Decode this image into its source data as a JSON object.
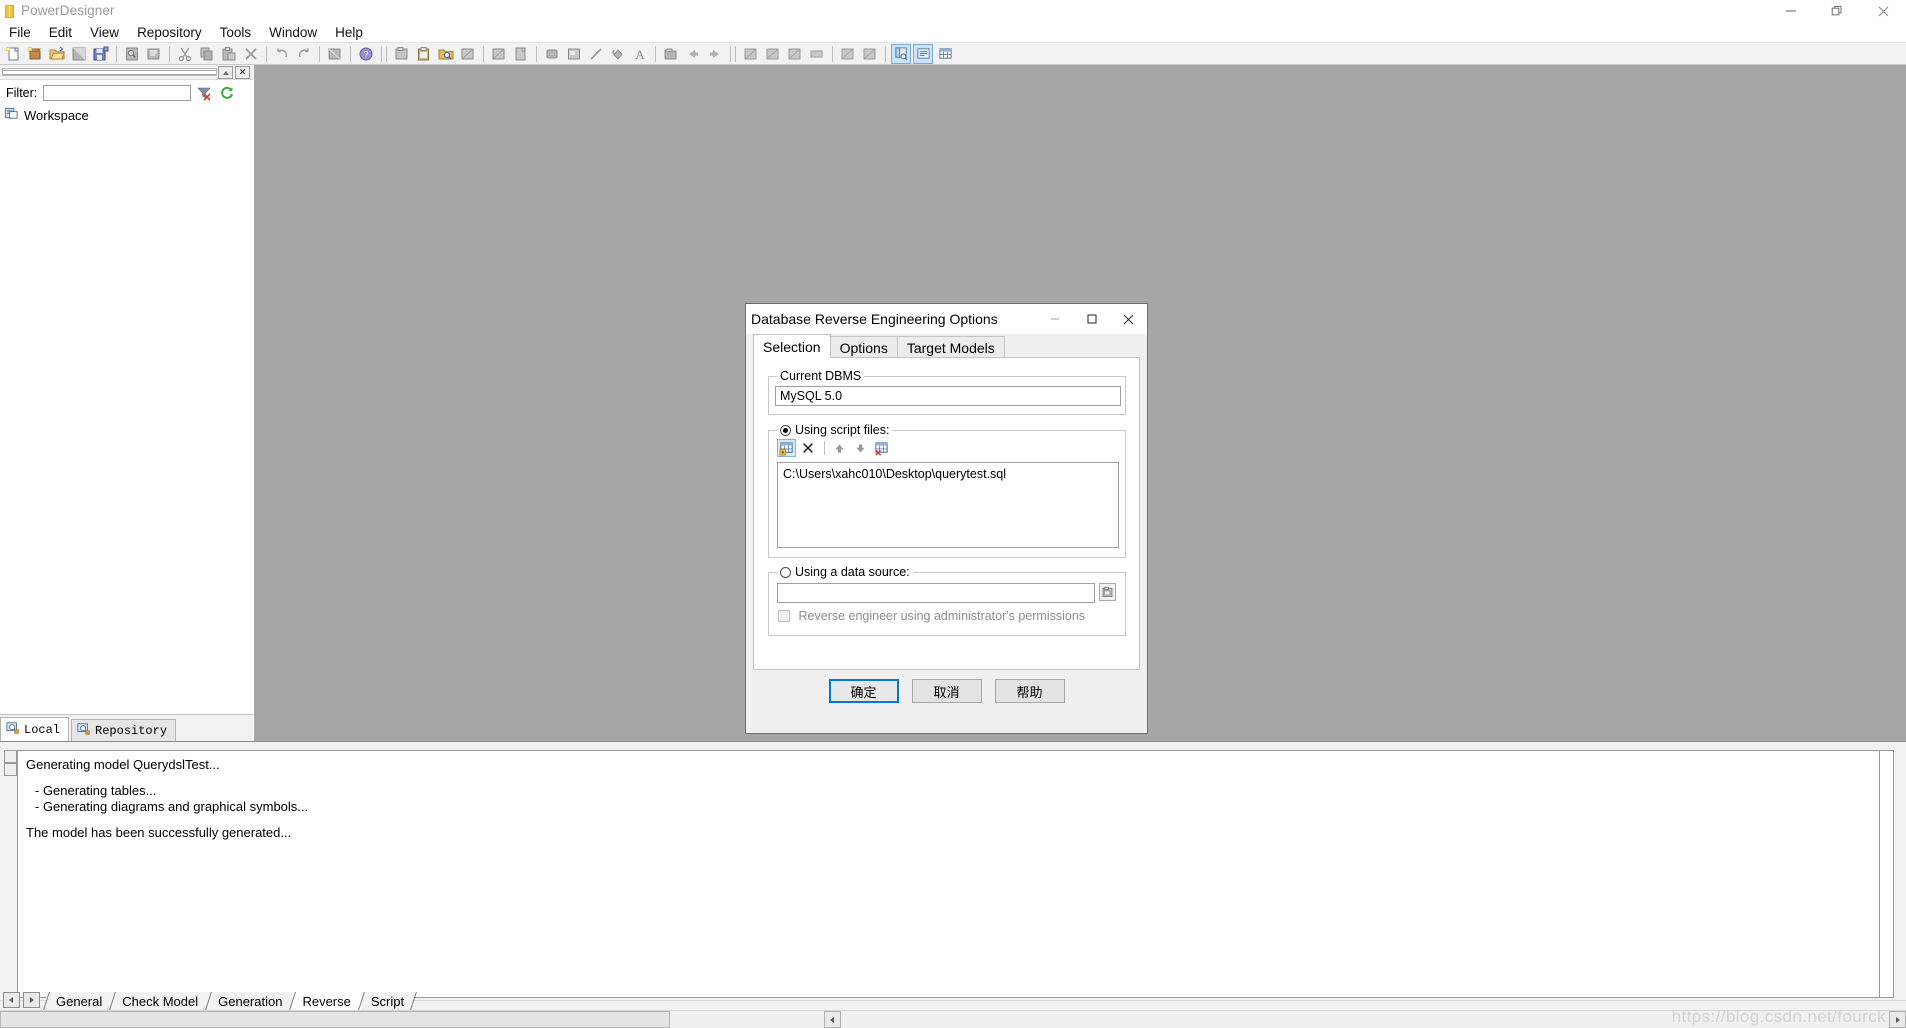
{
  "app": {
    "title": "PowerDesigner",
    "window_icon": "powerdesigner-icon",
    "window_buttons": [
      "minimize-icon",
      "restore-icon",
      "close-icon"
    ]
  },
  "menubar": {
    "items": [
      {
        "label": "File",
        "name": "menu-file"
      },
      {
        "label": "Edit",
        "name": "menu-edit"
      },
      {
        "label": "View",
        "name": "menu-view"
      },
      {
        "label": "Repository",
        "name": "menu-repository"
      },
      {
        "label": "Tools",
        "name": "menu-tools"
      },
      {
        "label": "Window",
        "name": "menu-window"
      },
      {
        "label": "Help",
        "name": "menu-help"
      }
    ]
  },
  "toolbar": {
    "groups": [
      {
        "buttons": [
          "new-model-icon",
          "new-package-icon",
          "open-icon",
          "save-icon",
          "save-all-icon"
        ]
      },
      {
        "buttons": [
          "print-preview-icon",
          "print-icon"
        ]
      },
      {
        "buttons": [
          "cut-icon",
          "copy-icon",
          "paste-icon",
          "delete-icon"
        ]
      },
      {
        "buttons": [
          "undo-icon",
          "redo-icon"
        ]
      },
      {
        "buttons": [
          "properties-icon"
        ]
      },
      {
        "buttons": [
          "help-icon"
        ]
      },
      {
        "buttons": [
          "new-diagram-icon",
          "clipboard-icon",
          "find-folder-icon",
          "zoom-icon"
        ]
      },
      {
        "buttons": [
          "zoom-fit-icon",
          "page-icon"
        ]
      },
      {
        "buttons": [
          "shape-icon",
          "note-icon",
          "line-icon",
          "fill-icon",
          "text-icon"
        ]
      },
      {
        "buttons": [
          "package-icon",
          "link-left-icon",
          "link-right-icon"
        ]
      },
      {
        "buttons": [
          "view-a-icon",
          "view-b-icon",
          "view-c-icon",
          "view-d-icon"
        ]
      },
      {
        "buttons": [
          "view-e-icon",
          "view-f-icon"
        ]
      },
      {
        "buttons": [
          "browser-toggle-icon",
          "output-toggle-icon",
          "result-list-icon"
        ]
      }
    ]
  },
  "browser": {
    "grip_buttons": [
      "collapse-icon",
      "close-panel-icon"
    ],
    "filter": {
      "label": "Filter:",
      "value": "",
      "placeholder": "",
      "clear_icon": "clear-filter-icon",
      "refresh_icon": "refresh-icon"
    },
    "tree": [
      {
        "label": "Workspace",
        "icon": "workspace-icon"
      }
    ],
    "tabs": [
      {
        "label": "Local",
        "icon": "local-icon",
        "active": true
      },
      {
        "label": "Repository",
        "icon": "repository-icon",
        "active": false
      }
    ]
  },
  "output": {
    "lines": [
      {
        "text": "Generating model QuerydslTest...",
        "indent": false
      },
      {
        "text": "",
        "indent": false
      },
      {
        "text": "- Generating tables...",
        "indent": true
      },
      {
        "text": "- Generating diagrams and graphical symbols...",
        "indent": true
      },
      {
        "text": "",
        "indent": false
      },
      {
        "text": "The model has been successfully generated...",
        "indent": false
      }
    ],
    "tabs": [
      {
        "label": "General",
        "active": false
      },
      {
        "label": "Check Model",
        "active": false
      },
      {
        "label": "Generation",
        "active": false
      },
      {
        "label": "Reverse",
        "active": true
      },
      {
        "label": "Script",
        "active": false
      }
    ],
    "nav_prev_icon": "scroll-left-icon",
    "nav_next_icon": "scroll-right-icon",
    "watermark": "https://blog.csdn.net/fourck"
  },
  "dialog": {
    "title": "Database Reverse Engineering Options",
    "window_buttons": [
      "minimize-icon",
      "maximize-icon",
      "close-icon"
    ],
    "tabs": [
      {
        "label": "Selection",
        "active": true
      },
      {
        "label": "Options",
        "active": false
      },
      {
        "label": "Target Models",
        "active": false
      }
    ],
    "current_dbms": {
      "group_label": "Current DBMS",
      "value": "MySQL 5.0"
    },
    "script_files": {
      "group_label": "Using script files:",
      "selected": true,
      "toolbar": [
        {
          "name": "add-script-file-icon",
          "active": true
        },
        {
          "name": "delete-script-file-icon",
          "active": false
        },
        {
          "name": "move-up-icon",
          "active": false
        },
        {
          "name": "move-down-icon",
          "active": false
        },
        {
          "name": "remove-all-icon",
          "active": false
        }
      ],
      "files": [
        "C:\\Users\\xahc010\\Desktop\\querytest.sql"
      ]
    },
    "data_source": {
      "group_label": "Using a data source:",
      "selected": false,
      "value": "",
      "browse_icon": "data-source-browse-icon",
      "admin_checkbox": {
        "label": "Reverse engineer using administrator's permissions",
        "checked": false,
        "enabled": false
      }
    },
    "buttons": [
      {
        "label": "确定",
        "name": "ok-button",
        "default": true
      },
      {
        "label": "取消",
        "name": "cancel-button",
        "default": false
      },
      {
        "label": "帮助",
        "name": "help-button",
        "default": false
      }
    ]
  },
  "colors": {
    "workspace_bg": "#a6a6a6",
    "accent": "#0078d7",
    "dialog_bg": "#f0f0f0",
    "toolbar_bg": "#f2f2f2"
  }
}
